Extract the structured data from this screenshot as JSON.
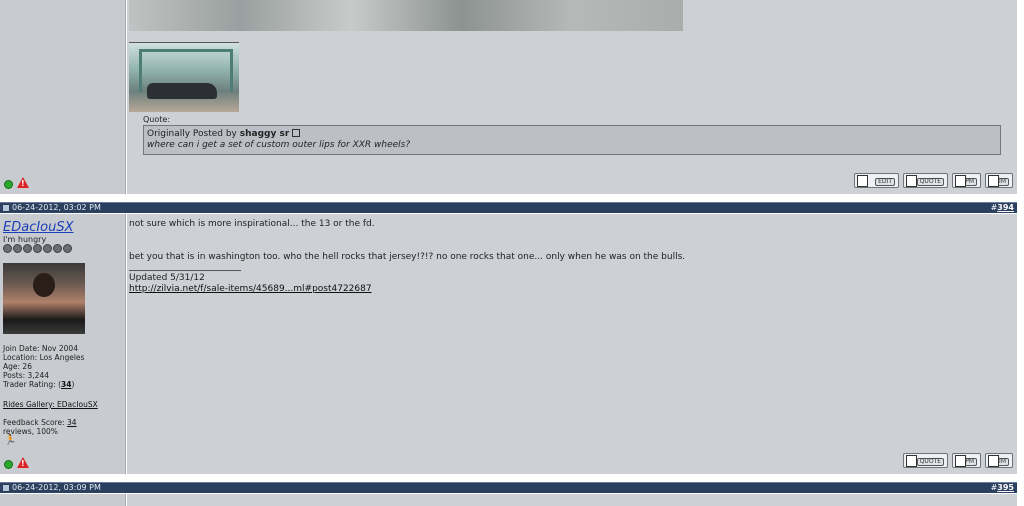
{
  "post1": {
    "quote_label": "Quote:",
    "quote_prefix": "Originally Posted by",
    "quote_author": "shaggy sr",
    "quote_text": "where can i get a set of custom outer lips for XXR wheels?",
    "buttons": [
      "EDIT",
      "QUOTE",
      "PM",
      "IM"
    ]
  },
  "post2": {
    "date": "06-24-2012, 03:02 PM",
    "number_prefix": "#",
    "number": "394",
    "username": "EDacIouSX",
    "user_title": "I'm hungry",
    "join_date": "Join Date: Nov 2004",
    "location": "Location: Los Angeles",
    "age": "Age: 26",
    "posts": "Posts: 3,244",
    "trader_rating_label": "Trader Rating: (",
    "trader_rating_value": "34",
    "trader_rating_close": ")",
    "rides_gallery": "Rides Gallery: EDacIouSX",
    "feedback_label": "Feedback Score: ",
    "feedback_value": "34",
    "feedback_reviews": "reviews, 100%",
    "body_line1": "not sure which is more inspirational... the 13 or the fd.",
    "body_line2": "bet you that is in washington too. who the hell rocks that jersey!?!? no one rocks that one... only when he was on the bulls.",
    "sig_line1": "Updated 5/31/12",
    "sig_link": "http://zilvia.net/f/sale-items/45689...ml#post4722687",
    "buttons": [
      "QUOTE",
      "PM",
      "IM"
    ]
  },
  "post3": {
    "date": "06-24-2012, 03:09 PM",
    "number_prefix": "#",
    "number": "395"
  },
  "colors": {
    "header_bar": "#2b3f5e",
    "sidebar": "#c8cbd0",
    "content": "#cdd0d5",
    "username": "#1b3fb8"
  }
}
